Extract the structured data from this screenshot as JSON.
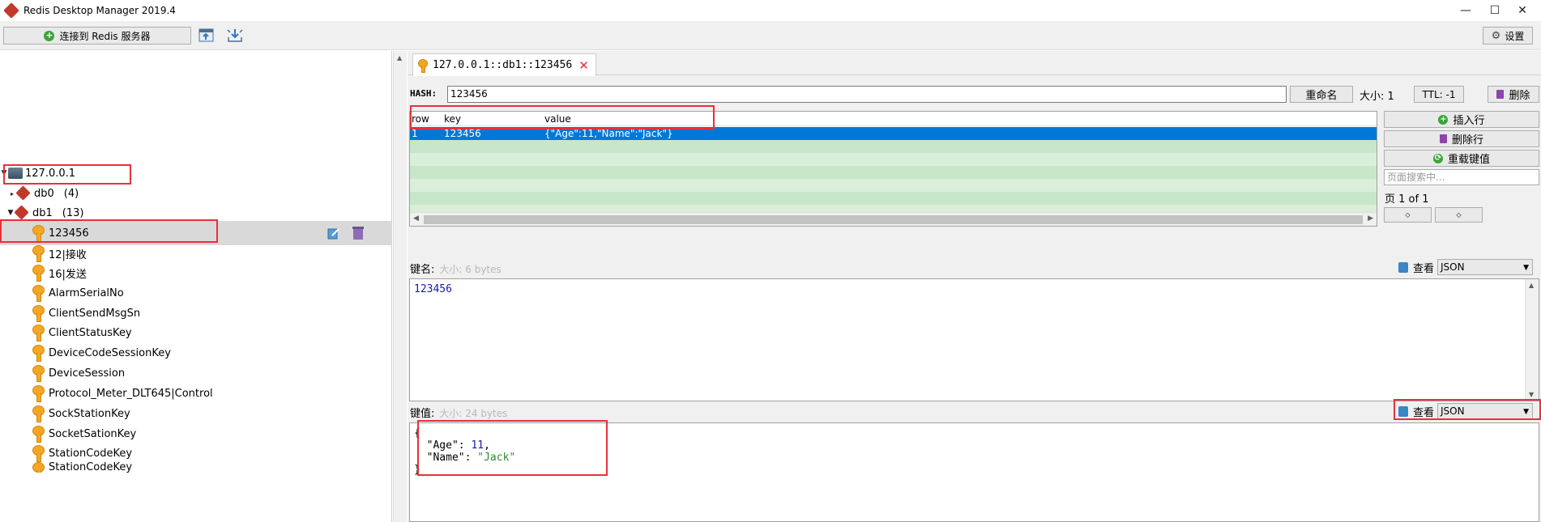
{
  "window": {
    "title": "Redis Desktop Manager 2019.4",
    "minimize": "—",
    "maximize": "☐",
    "close": "✕"
  },
  "toolbar": {
    "connect_label": "连接到 Redis 服务器",
    "settings_label": "设置"
  },
  "tree": {
    "server": "127.0.0.1",
    "databases": [
      {
        "name": "db0",
        "count": "(4)",
        "expanded": false
      },
      {
        "name": "db1",
        "count": "(13)",
        "expanded": true
      }
    ],
    "keys": [
      "123456",
      "12|接收",
      "16|发送",
      "AlarmSerialNo",
      "ClientSendMsgSn",
      "ClientStatusKey",
      "DeviceCodeSessionKey",
      "DeviceSession",
      "Protocol_Meter_DLT645|Control",
      "SockStationKey",
      "SocketSationKey",
      "StationCodeKey",
      "StationCodeKey"
    ],
    "selected_key": "123456"
  },
  "tab": {
    "label": "127.0.0.1::db1::123456"
  },
  "key_header": {
    "type_label": "HASH:",
    "key_name": "123456",
    "rename_label": "重命名",
    "size_label": "大小: 1",
    "ttl_label": "TTL: -1",
    "delete_label": "删除"
  },
  "table": {
    "columns": [
      "row",
      "key",
      "value"
    ],
    "rows": [
      {
        "row": "1",
        "key": "123456",
        "value": "{\"Age\":11,\"Name\":\"Jack\"}"
      }
    ]
  },
  "actions": {
    "insert_row": "插入行",
    "delete_row": "删除行",
    "reload": "重载键值",
    "search_placeholder": "页面搜索中...",
    "page_indicator": "页  1  of 1",
    "prev": "◇",
    "next": "◇"
  },
  "key_name_section": {
    "label": "键名:",
    "size": "大小: 6 bytes",
    "view_label": "查看",
    "format": "JSON",
    "content": "123456"
  },
  "key_value_section": {
    "label": "键值:",
    "size": "大小: 24 bytes",
    "view_label": "查看",
    "format": "JSON",
    "lines": {
      "open": "{",
      "age_key": "\"Age\"",
      "age_val": "11",
      "name_key": "\"Name\"",
      "name_val": "\"Jack\"",
      "close": "}"
    }
  },
  "colors": {
    "accent_blue": "#0078d7",
    "highlight_red": "#e8313a",
    "table_stripe_a": "#c8e6c9",
    "table_stripe_b": "#d9efd9",
    "json_number": "#1a1aa6",
    "json_string": "#2e8b2e"
  }
}
